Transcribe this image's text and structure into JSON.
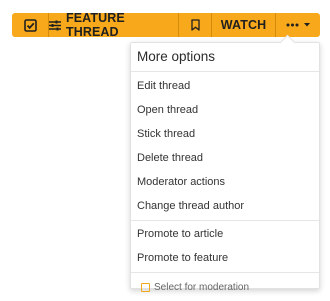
{
  "toolbar": {
    "check_icon": "checkbox-check-icon",
    "feature_icon": "sliders-icon",
    "feature_label": "FEATURE THREAD",
    "bookmark_icon": "bookmark-icon",
    "watch_label": "WATCH",
    "more_icon": "ellipsis-icon",
    "caret_icon": "caret-down-icon",
    "accent_color": "#f7a81b"
  },
  "menu": {
    "title": "More options",
    "group1": [
      {
        "label": "Edit thread"
      },
      {
        "label": "Open thread"
      },
      {
        "label": "Stick thread"
      },
      {
        "label": "Delete thread"
      },
      {
        "label": "Moderator actions"
      },
      {
        "label": "Change thread author"
      }
    ],
    "group2": [
      {
        "label": "Promote to article"
      },
      {
        "label": "Promote to feature"
      }
    ],
    "footer_label": "Select for moderation"
  }
}
